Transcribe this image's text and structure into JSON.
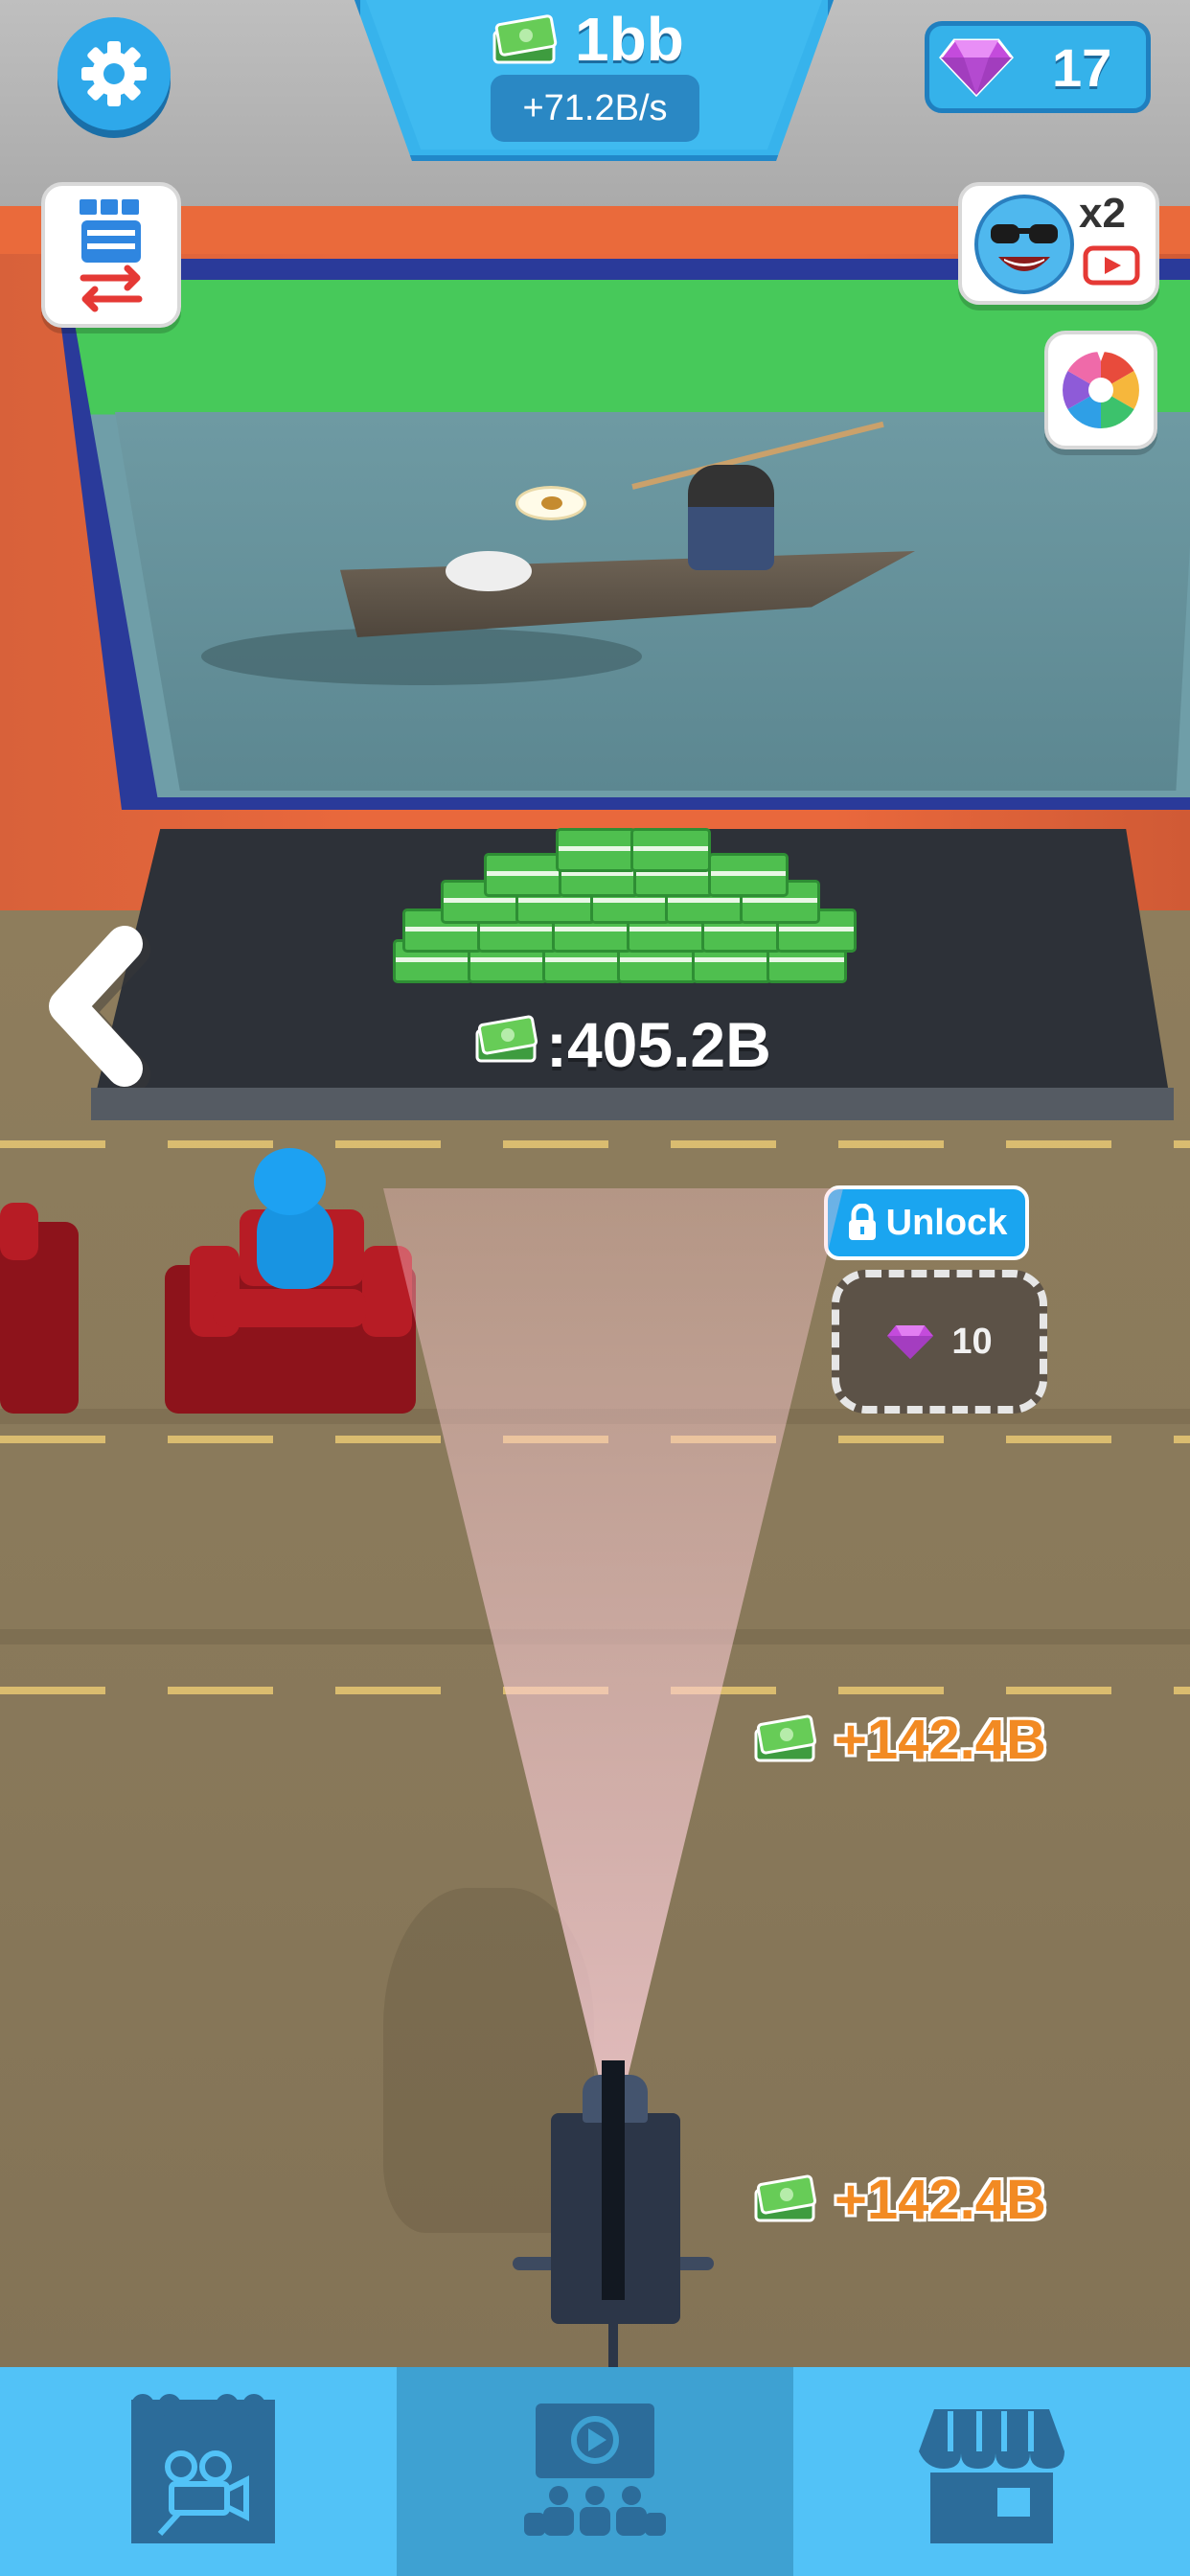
{
  "hud": {
    "money": "1bb",
    "income_rate": "+71.2B/s",
    "gems": "17",
    "boost_multiplier": "x2"
  },
  "tray": {
    "cash_label": ":405.2B"
  },
  "unlock": {
    "button_label": "Unlock",
    "gem_cost": "10"
  },
  "income_popups": [
    {
      "text": "+142.4B"
    },
    {
      "text": "+142.4B"
    }
  ],
  "bottom_nav": {
    "tabs": [
      {
        "icon": "cinema-studio-icon",
        "active": false
      },
      {
        "icon": "theater-screen-icon",
        "active": true
      },
      {
        "icon": "shop-icon",
        "active": false
      }
    ]
  },
  "colors": {
    "hud_blue": "#37b3ec",
    "income_orange": "#f28a23",
    "gem_purple": "#c44bdc",
    "cash_green": "#4fbf4f",
    "seat_red": "#b71c25"
  }
}
